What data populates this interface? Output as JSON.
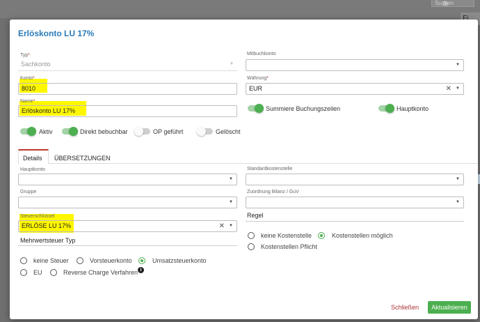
{
  "background": {
    "search_text": "Suchen",
    "icon": "⊞",
    "fi_text": "Fi"
  },
  "modal": {
    "title": "Erlöskonto LU 17%"
  },
  "form": {
    "typ": {
      "label": "Typ",
      "value": "Sachkonto"
    },
    "konto": {
      "label": "Konto",
      "value": "8010"
    },
    "name": {
      "label": "Name",
      "value": "Erlöskonto LU 17%"
    },
    "mitbuchkonto": {
      "label": "Mitbuchkonto",
      "value": ""
    },
    "waehrung": {
      "label": "Währung",
      "value": "EUR"
    },
    "toggles": [
      {
        "label": "Aktiv",
        "on": true
      },
      {
        "label": "Direkt bebuchbar",
        "on": true
      },
      {
        "label": "OP geführt",
        "on": false
      },
      {
        "label": "Gelöscht",
        "on": false
      }
    ],
    "right_toggles": [
      {
        "label": "Summiere Buchungszeilen",
        "on": true
      },
      {
        "label": "Hauptkonto",
        "on": true
      }
    ]
  },
  "tabs": [
    {
      "label": "Details",
      "active": true
    },
    {
      "label": "ÜBERSETZUNGEN",
      "active": false
    }
  ],
  "details": {
    "hauptkonto": {
      "label": "Hauptkonto",
      "value": ""
    },
    "gruppe": {
      "label": "Gruppe",
      "value": ""
    },
    "steuerschluessel": {
      "label": "Steuerschlüssel",
      "value": "ERLÖSE LU 17%"
    },
    "standardkostenstelle": {
      "label": "Standardkostenstelle",
      "value": ""
    },
    "zuordnung": {
      "label": "Zuordnung Bilanz / GuV",
      "value": ""
    },
    "mwst_title": "Mehrwertsteuer Typ",
    "mwst_options": [
      "keine Steuer",
      "Vorsteuerkonto",
      "Umsatzsteuerkonto",
      "EU",
      "Reverse Charge Verfahren"
    ],
    "mwst_selected": "Umsatzsteuerkonto",
    "regel_title": "Regel",
    "regel_options": [
      "keine Kostenstelle",
      "Kostenstellen möglich",
      "Kostenstellen Pflicht"
    ],
    "regel_selected": "Kostenstellen möglich"
  },
  "footer": {
    "close_label": "Schließen",
    "update_label": "Aktualisieren"
  },
  "colors": {
    "accent": "#4caf50",
    "title": "#2a7ab8",
    "highlight": "#fff700",
    "danger": "#a33333"
  }
}
